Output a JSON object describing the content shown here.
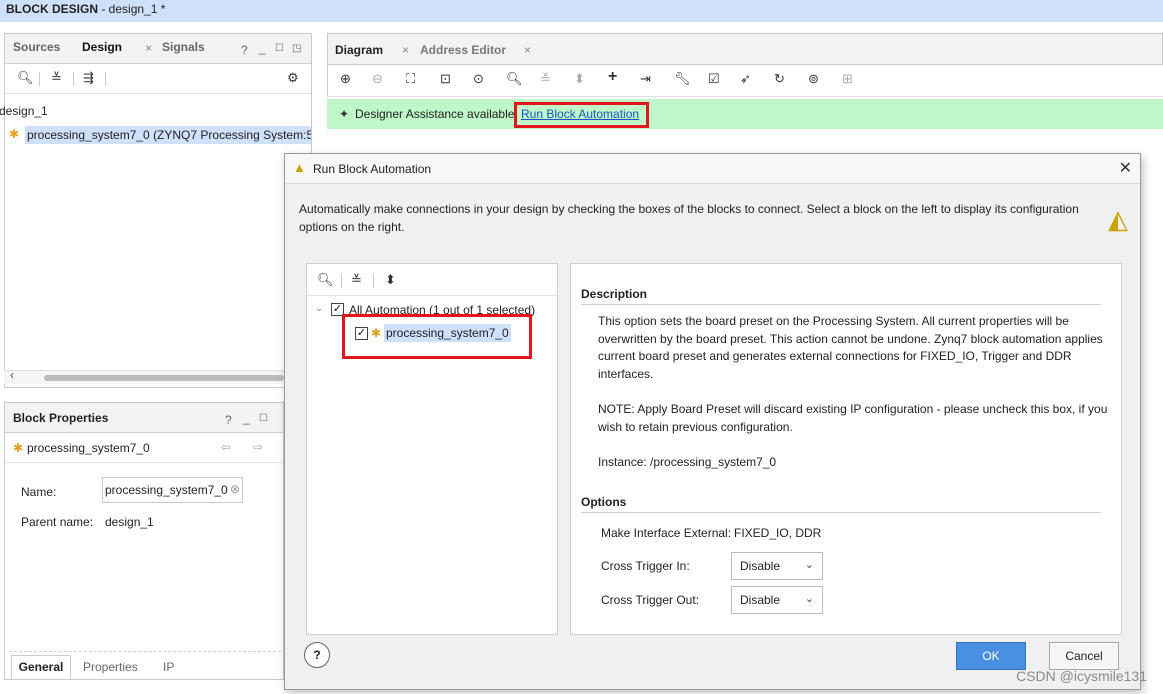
{
  "window": {
    "title_bold": "BLOCK DESIGN",
    "title_rest": " - design_1 *"
  },
  "left_tabs": [
    "Sources",
    "Design",
    "Signals"
  ],
  "left_tree": {
    "root": "design_1",
    "item": "processing_system7_0 (ZYNQ7 Processing System:5."
  },
  "block_props": {
    "title": "Block Properties",
    "selected": "processing_system7_0",
    "name_label": "Name:",
    "name_value": "processing_system7_0",
    "parent_label": "Parent name:",
    "parent_value": "design_1",
    "bottom_tabs": [
      "General",
      "Properties",
      "IP"
    ]
  },
  "diagram_tabs": [
    "Diagram",
    "Address Editor"
  ],
  "assist": {
    "text": "Designer Assistance available.",
    "link": "Run Block Automation"
  },
  "dialog": {
    "title": "Run Block Automation",
    "intro": "Automatically make connections in your design by checking the boxes of the blocks to connect. Select a block on the left to display its configuration options on the right.",
    "tree_root": "All Automation (1 out of 1 selected)",
    "tree_item": "processing_system7_0",
    "description_heading": "Description",
    "description_p1": "This option sets the board preset on the Processing System. All current properties will be overwritten by the board preset. This action cannot be undone. Zynq7 block automation applies current board preset and generates external connections for FIXED_IO, Trigger and DDR interfaces.",
    "description_p2": "NOTE: Apply Board Preset will discard existing IP configuration - please uncheck this box, if you wish to retain previous configuration.",
    "description_p3": "Instance: /processing_system7_0",
    "options_heading": "Options",
    "make_external_label": "Make Interface External:",
    "make_external_value": "FIXED_IO, DDR",
    "cross_trigger_in_label": "Cross Trigger In:",
    "cross_trigger_in_value": "Disable",
    "cross_trigger_out_label": "Cross Trigger Out:",
    "cross_trigger_out_value": "Disable",
    "ok_label": "OK",
    "cancel_label": "Cancel",
    "help_label": "?"
  },
  "watermark": "CSDN @icysmile131",
  "colors": {
    "accent": "#4a90e2",
    "highlight_red": "#e3141c",
    "assist_green": "#bff7c8",
    "selection_blue": "#cfe0fb"
  }
}
